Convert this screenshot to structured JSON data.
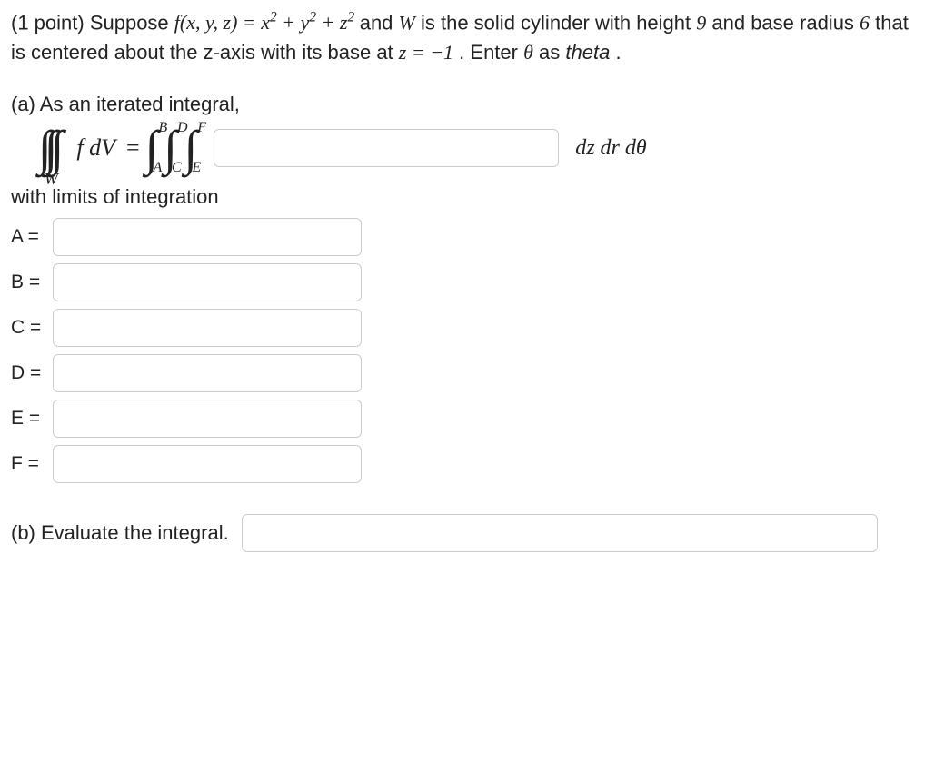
{
  "problem": {
    "points_prefix": "(1 point) Suppose ",
    "func_lhs": "f(x, y, z) = x",
    "func_mid1": " + y",
    "func_mid2": " + z",
    "desc1": " and ",
    "W": "W",
    "desc2": " is the solid cylinder with height ",
    "height": "9",
    "desc3": " and base radius ",
    "radius": "6",
    "desc4": " that is centered about the z-axis with its base at ",
    "zeq": "z = −1",
    "desc5": ". Enter ",
    "theta_sym": "θ",
    "desc6": " as ",
    "theta_word": "theta",
    "desc7": "."
  },
  "part_a": {
    "label": "(a) As an iterated integral,",
    "fdV": "f dV",
    "equals": " = ",
    "bounds": {
      "outer_upper": "B",
      "outer_lower": "A",
      "mid_upper": "D",
      "mid_lower": "C",
      "inner_upper": "F",
      "inner_lower": "E"
    },
    "differentials": "dz dr dθ",
    "limits_text": "with limits of integration",
    "rows": [
      {
        "label": "A ="
      },
      {
        "label": "B ="
      },
      {
        "label": "C ="
      },
      {
        "label": "D ="
      },
      {
        "label": "E ="
      },
      {
        "label": "F ="
      }
    ],
    "W_sub": "W"
  },
  "part_b": {
    "label": "(b) Evaluate the integral."
  }
}
